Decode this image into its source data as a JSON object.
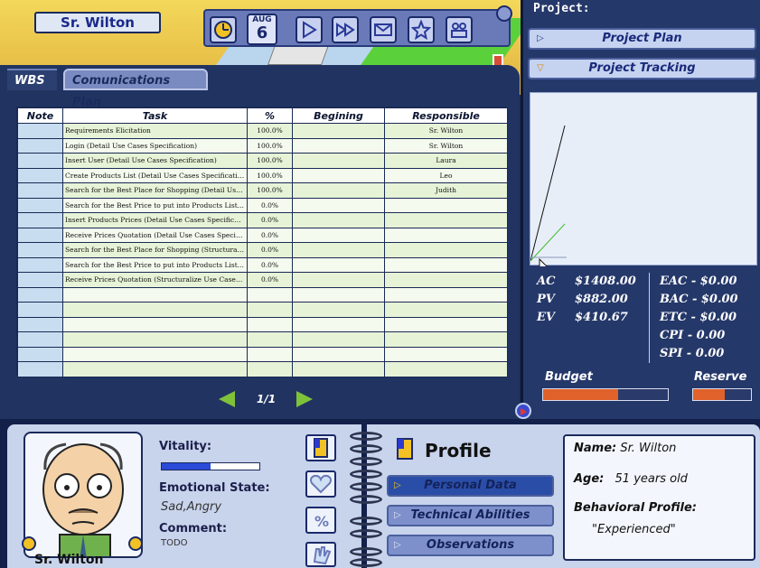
{
  "header": {
    "character_name": "Sr. Wilton",
    "date_month": "AUG",
    "date_day": "6"
  },
  "tabs": {
    "wbs": "WBS",
    "communications": "Comunications Plan"
  },
  "table": {
    "columns": [
      "Note",
      "Task",
      "%",
      "Begining",
      "Responsible"
    ],
    "rows": [
      {
        "note": "",
        "task": "Requirements Elicitation",
        "pct": "100.0%",
        "begin": "",
        "resp": "Sr. Wilton"
      },
      {
        "note": "",
        "task": "Login (Detail Use Cases Specification)",
        "pct": "100.0%",
        "begin": "",
        "resp": "Sr. Wilton"
      },
      {
        "note": "",
        "task": "Insert User (Detail Use Cases Specification)",
        "pct": "100.0%",
        "begin": "",
        "resp": "Laura"
      },
      {
        "note": "",
        "task": "Create Products List (Detail Use Cases Specificatio...",
        "pct": "100.0%",
        "begin": "",
        "resp": "Leo"
      },
      {
        "note": "",
        "task": "Search for the Best Place for Shopping (Detail Use...",
        "pct": "100.0%",
        "begin": "",
        "resp": "Judith"
      },
      {
        "note": "",
        "task": "Search for the Best Price to put into Products List...",
        "pct": "0.0%",
        "begin": "",
        "resp": ""
      },
      {
        "note": "",
        "task": "Insert Products Prices (Detail Use Cases Specificat...",
        "pct": "0.0%",
        "begin": "",
        "resp": ""
      },
      {
        "note": "",
        "task": "Receive Prices Quotation (Detail Use Cases Specifi...",
        "pct": "0.0%",
        "begin": "",
        "resp": ""
      },
      {
        "note": "",
        "task": "Search for the Best Place for Shopping (Structurali...",
        "pct": "0.0%",
        "begin": "",
        "resp": ""
      },
      {
        "note": "",
        "task": "Search for the Best Price to put into Products List...",
        "pct": "0.0%",
        "begin": "",
        "resp": ""
      },
      {
        "note": "",
        "task": "Receive Prices Quotation (Structuralize Use Cases ...",
        "pct": "0.0%",
        "begin": "",
        "resp": ""
      },
      {
        "note": "",
        "task": "",
        "pct": "",
        "begin": "",
        "resp": ""
      },
      {
        "note": "",
        "task": "",
        "pct": "",
        "begin": "",
        "resp": ""
      },
      {
        "note": "",
        "task": "",
        "pct": "",
        "begin": "",
        "resp": ""
      },
      {
        "note": "",
        "task": "",
        "pct": "",
        "begin": "",
        "resp": ""
      },
      {
        "note": "",
        "task": "",
        "pct": "",
        "begin": "",
        "resp": ""
      },
      {
        "note": "",
        "task": "",
        "pct": "",
        "begin": "",
        "resp": ""
      }
    ]
  },
  "pager": {
    "text": "1/1"
  },
  "project": {
    "title": "Project:",
    "plan_label": "Project Plan",
    "tracking_label": "Project Tracking",
    "metrics": {
      "ac_label": "AC",
      "ac_value": "$1408.00",
      "pv_label": "PV",
      "pv_value": "$882.00",
      "ev_label": "EV",
      "ev_value": "$410.67",
      "eac": "EAC - $0.00",
      "bac": "BAC - $0.00",
      "etc": "ETC - $0.00",
      "cpi": "CPI -  0.00",
      "spi": "SPI -  0.00"
    },
    "budget_label": "Budget",
    "reserve_label": "Reserve",
    "budget_fill": 0.6,
    "reserve_fill": 0.55,
    "colors": {
      "ac_line": "#111111",
      "ev_line": "#3dbb2a",
      "pv_line": "#8899bb"
    }
  },
  "character": {
    "name": "Sr. Wilton",
    "vitality_label": "Vitality:",
    "vitality": 0.5,
    "emotional_label": "Emotional State:",
    "emotional_value": "Sad,Angry",
    "comment_label": "Comment:",
    "comment_value": "TODO"
  },
  "profile": {
    "title": "Profile",
    "personal_data": "Personal Data",
    "technical_abilities": "Technical Abilities",
    "observations": "Observations",
    "name_label": "Name:",
    "name_value": "Sr. Wilton",
    "age_label": "Age:",
    "age_value": "51 years old",
    "behavior_label": "Behavioral Profile:",
    "behavior_value": "\"Experienced\""
  }
}
